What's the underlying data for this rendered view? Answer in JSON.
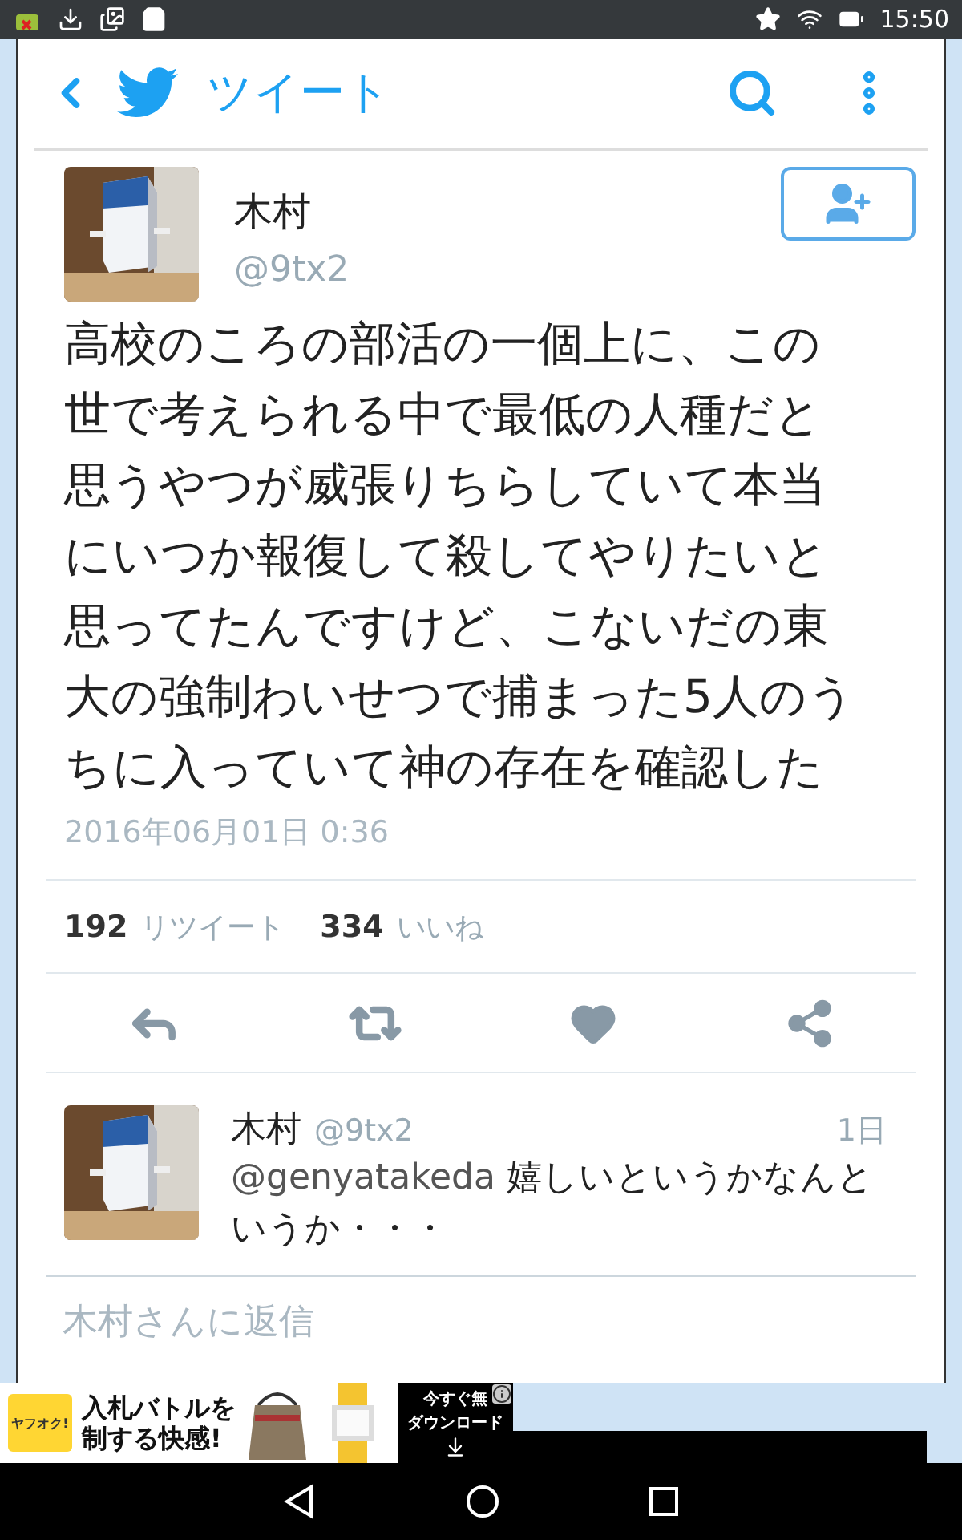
{
  "status_bar": {
    "time": "15:50"
  },
  "header": {
    "title": "ツイート"
  },
  "tweet": {
    "name": "木村",
    "handle": "@9tx2",
    "text": "高校のころの部活の一個上に、この世で考えられる中で最低の人種だと思うやつが威張りちらしていて本当にいつか報復して殺してやりたいと思ってたんですけど、こないだの東大の強制わいせつで捕まった5人のうちに入っていて神の存在を確認した",
    "date": "2016年06月01日 0:36",
    "stats": [
      {
        "count": "192",
        "label": "リツイート"
      },
      {
        "count": "334",
        "label": "いいね"
      }
    ],
    "actions": [
      {
        "kind": "reply"
      },
      {
        "kind": "retweet"
      },
      {
        "kind": "like"
      },
      {
        "kind": "share"
      }
    ]
  },
  "replies": [
    {
      "name": "木村",
      "handle": "@9tx2",
      "time": "1日",
      "mention": "@genyatakeda",
      "text": "嬉しいというかなんというか・・・"
    }
  ],
  "reply_field": {
    "placeholder": "木村さんに返信"
  },
  "ad": {
    "lines": [
      "入札バトルを",
      "制する快感!"
    ],
    "logo": "ヤフオク!",
    "button_lines": [
      "今すぐ無",
      "ダウンロード"
    ]
  }
}
